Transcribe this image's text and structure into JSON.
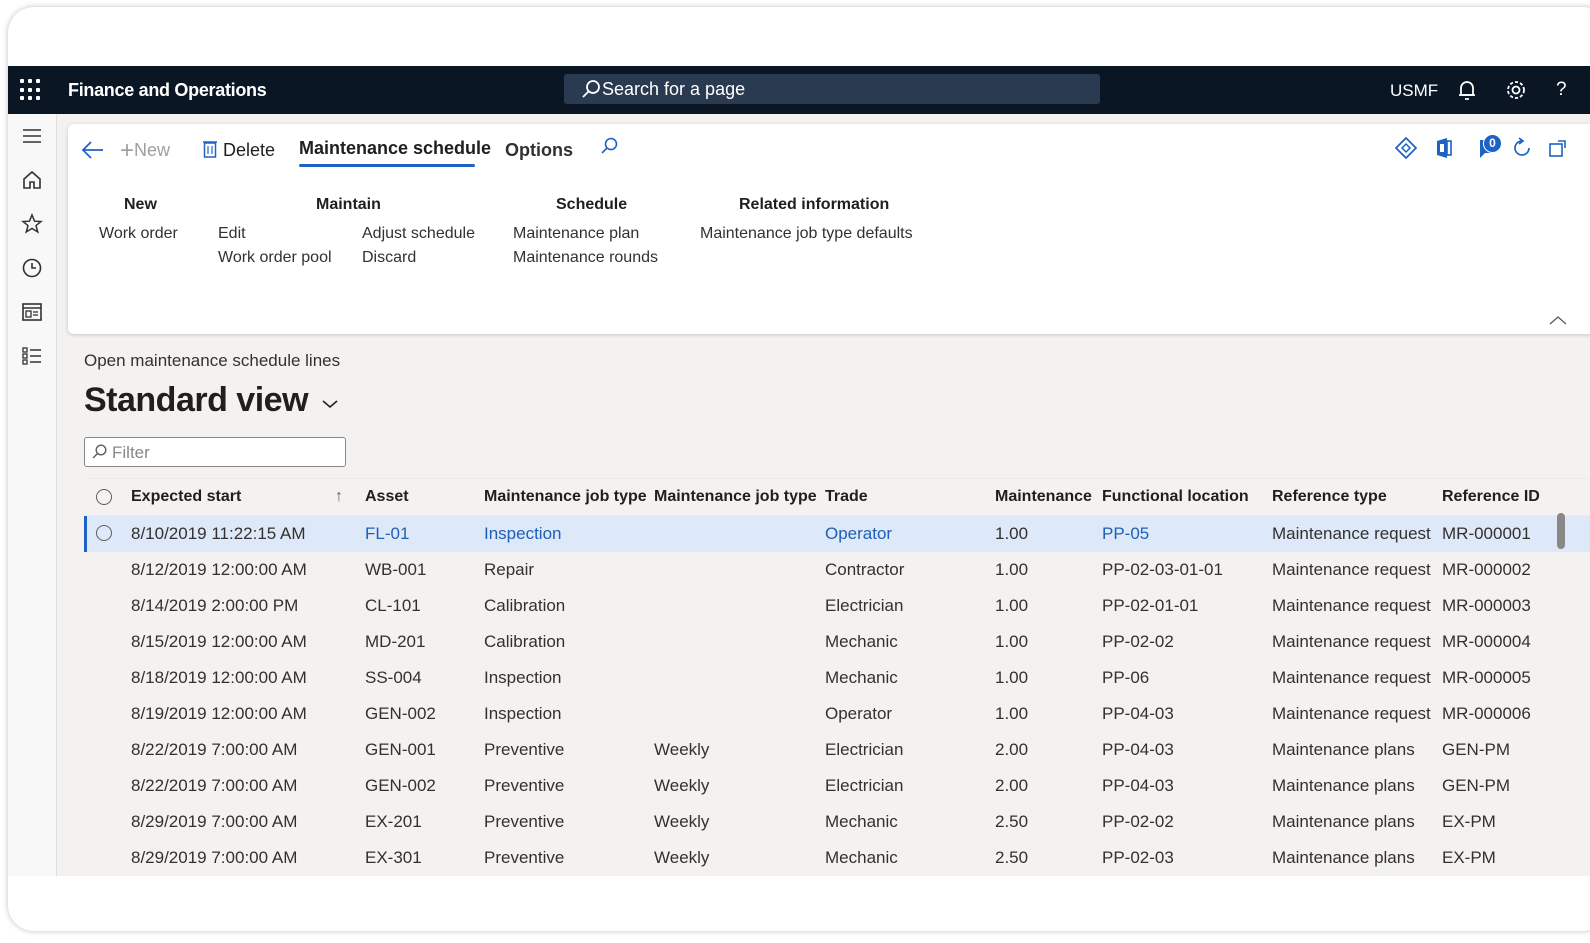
{
  "app": {
    "title": "Finance and Operations",
    "search_placeholder": "Search for a page",
    "company": "USMF",
    "help_glyph": "?"
  },
  "actionpane": {
    "back_icon": "back-arrow-icon",
    "new_label": "New",
    "delete_label": "Delete",
    "tabs": [
      {
        "label": "Maintenance schedule",
        "active": true
      },
      {
        "label": "Options",
        "active": false
      }
    ],
    "notification_count": "0",
    "groups": {
      "new": {
        "title": "New",
        "items": [
          "Work order"
        ]
      },
      "maintain": {
        "title": "Maintain",
        "col1": [
          "Edit",
          "Work order pool"
        ],
        "col2": [
          "Adjust schedule",
          "Discard"
        ]
      },
      "schedule": {
        "title": "Schedule",
        "items": [
          "Maintenance plan",
          "Maintenance rounds"
        ]
      },
      "related": {
        "title": "Related information",
        "items": [
          "Maintenance job type defaults"
        ]
      }
    }
  },
  "page": {
    "caption": "Open maintenance schedule lines",
    "view_name": "Standard view",
    "filter_placeholder": "Filter"
  },
  "grid": {
    "columns": [
      "Expected start",
      "Asset",
      "Maintenance job type",
      "Maintenance job type",
      "Trade",
      "Maintenance",
      "Functional location",
      "Reference type",
      "Reference ID"
    ],
    "sort_indicator": "↑",
    "rows": [
      {
        "start": "8/10/2019 11:22:15 AM",
        "asset": "FL-01",
        "jobtype": "Inspection",
        "variant": "",
        "trade": "Operator",
        "hours": "1.00",
        "location": "PP-05",
        "reftype": "Maintenance request",
        "refid": "MR-000001",
        "selected": true
      },
      {
        "start": "8/12/2019 12:00:00 AM",
        "asset": "WB-001",
        "jobtype": "Repair",
        "variant": "",
        "trade": "Contractor",
        "hours": "1.00",
        "location": "PP-02-03-01-01",
        "reftype": "Maintenance request",
        "refid": "MR-000002"
      },
      {
        "start": "8/14/2019 2:00:00 PM",
        "asset": "CL-101",
        "jobtype": "Calibration",
        "variant": "",
        "trade": "Electrician",
        "hours": "1.00",
        "location": "PP-02-01-01",
        "reftype": "Maintenance request",
        "refid": "MR-000003"
      },
      {
        "start": "8/15/2019 12:00:00 AM",
        "asset": "MD-201",
        "jobtype": "Calibration",
        "variant": "",
        "trade": "Mechanic",
        "hours": "1.00",
        "location": "PP-02-02",
        "reftype": "Maintenance request",
        "refid": "MR-000004"
      },
      {
        "start": "8/18/2019 12:00:00 AM",
        "asset": "SS-004",
        "jobtype": "Inspection",
        "variant": "",
        "trade": "Mechanic",
        "hours": "1.00",
        "location": "PP-06",
        "reftype": "Maintenance request",
        "refid": "MR-000005"
      },
      {
        "start": "8/19/2019 12:00:00 AM",
        "asset": "GEN-002",
        "jobtype": "Inspection",
        "variant": "",
        "trade": "Operator",
        "hours": "1.00",
        "location": "PP-04-03",
        "reftype": "Maintenance request",
        "refid": "MR-000006"
      },
      {
        "start": "8/22/2019 7:00:00 AM",
        "asset": "GEN-001",
        "jobtype": "Preventive",
        "variant": "Weekly",
        "trade": "Electrician",
        "hours": "2.00",
        "location": "PP-04-03",
        "reftype": "Maintenance plans",
        "refid": "GEN-PM"
      },
      {
        "start": "8/22/2019 7:00:00 AM",
        "asset": "GEN-002",
        "jobtype": "Preventive",
        "variant": "Weekly",
        "trade": "Electrician",
        "hours": "2.00",
        "location": "PP-04-03",
        "reftype": "Maintenance plans",
        "refid": "GEN-PM"
      },
      {
        "start": "8/29/2019 7:00:00 AM",
        "asset": "EX-201",
        "jobtype": "Preventive",
        "variant": "Weekly",
        "trade": "Mechanic",
        "hours": "2.50",
        "location": "PP-02-02",
        "reftype": "Maintenance plans",
        "refid": "EX-PM"
      },
      {
        "start": "8/29/2019 7:00:00 AM",
        "asset": "EX-301",
        "jobtype": "Preventive",
        "variant": "Weekly",
        "trade": "Mechanic",
        "hours": "2.50",
        "location": "PP-02-03",
        "reftype": "Maintenance plans",
        "refid": "EX-PM"
      }
    ]
  },
  "colors": {
    "accent": "#1e63c4",
    "topbar": "#0b1624",
    "selected_row": "#dde8f8"
  }
}
